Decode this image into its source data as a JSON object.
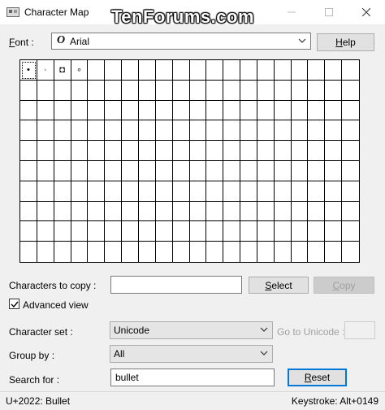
{
  "window": {
    "title": "Character Map",
    "watermark": "TenForums.com"
  },
  "font": {
    "label": "Font :",
    "label_u": "F",
    "label_rest": "ont :",
    "value": "Arial",
    "help_button": "Help",
    "help_u": "H",
    "help_rest": "elp"
  },
  "grid": {
    "cells": [
      "•",
      "·",
      "◘",
      "∘"
    ],
    "columns": 20,
    "rows": 10
  },
  "copy": {
    "label": "Characters to copy :",
    "label_u": "h",
    "value": "",
    "select_button": "Select",
    "select_u": "S",
    "select_rest": "elect",
    "copy_button": "Copy",
    "copy_u": "C",
    "copy_rest": "opy"
  },
  "advanced_view": {
    "label": "Advanced view",
    "label_u": "d",
    "checked": true
  },
  "character_set": {
    "label": "Character set :",
    "value": "Unicode"
  },
  "goto_unicode": {
    "label": "Go to Unicode :",
    "label_u": "U",
    "value": ""
  },
  "group_by": {
    "label": "Group by :",
    "value": "All"
  },
  "search": {
    "label": "Search for :",
    "value": "bullet",
    "reset_button": "Reset",
    "reset_u": "R",
    "reset_rest": "eset"
  },
  "status": {
    "left": "U+2022: Bullet",
    "right": "Keystroke: Alt+0149"
  }
}
